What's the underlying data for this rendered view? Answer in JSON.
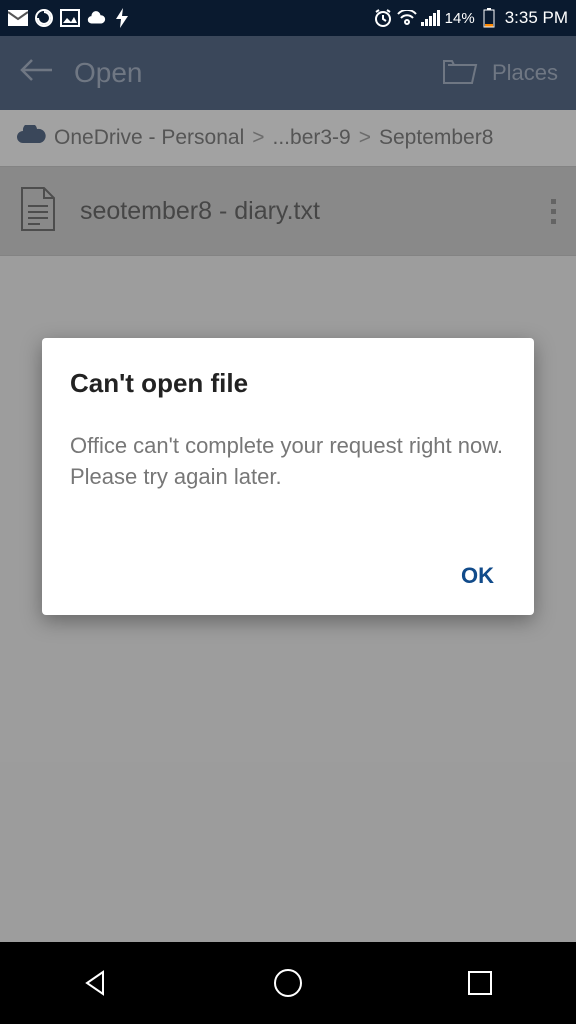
{
  "status": {
    "battery_pct": "14%",
    "time": "3:35 PM"
  },
  "header": {
    "title": "Open",
    "places": "Places"
  },
  "breadcrumb": {
    "items": [
      "OneDrive - Personal",
      "...ber3-9",
      "September8"
    ]
  },
  "file": {
    "name": "seotember8 - diary.txt"
  },
  "dialog": {
    "title": "Can't open file",
    "message": "Office can't complete your request right now. Please try again later.",
    "ok": "OK"
  }
}
